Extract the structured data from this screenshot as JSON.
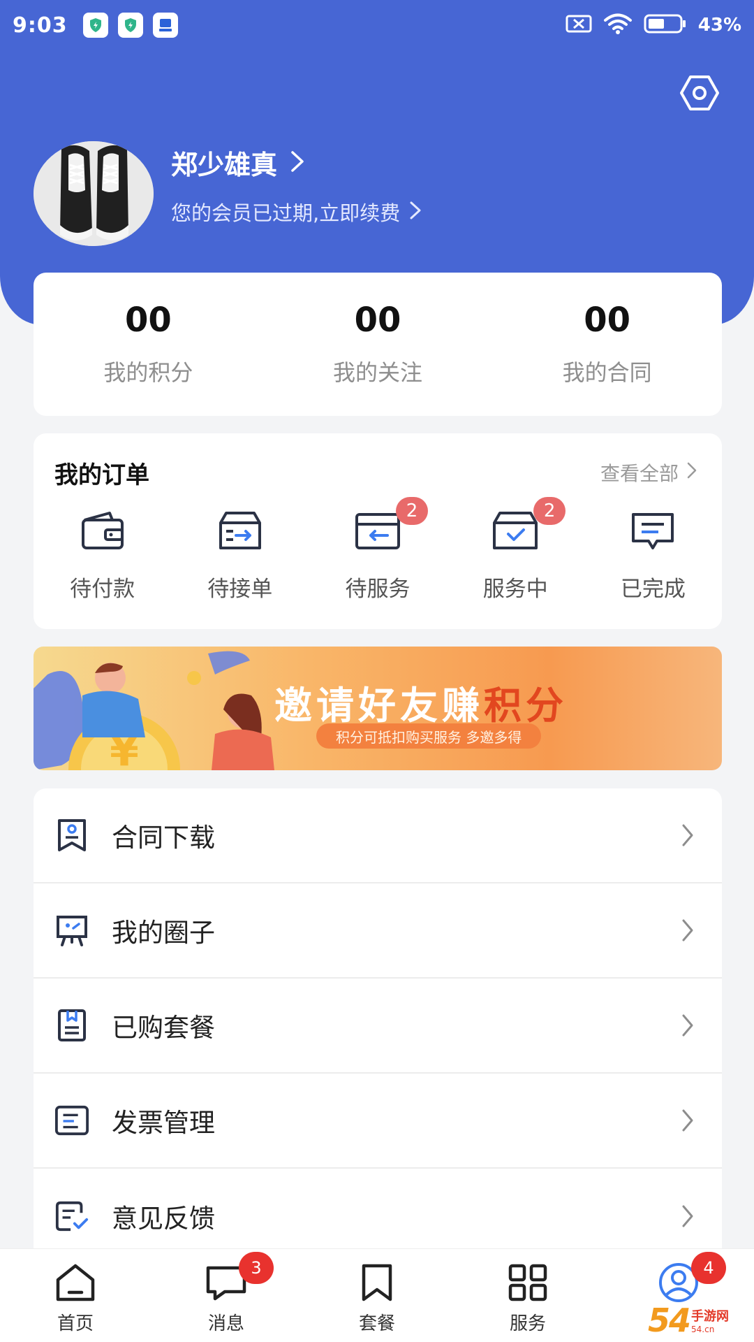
{
  "status_bar": {
    "time": "9:03",
    "battery": "43%"
  },
  "profile": {
    "name": "郑少雄真",
    "membership_notice": "您的会员已过期,立即续费"
  },
  "stats": [
    {
      "value": "00",
      "label": "我的积分"
    },
    {
      "value": "00",
      "label": "我的关注"
    },
    {
      "value": "00",
      "label": "我的合同"
    }
  ],
  "orders": {
    "title": "我的订单",
    "view_all": "查看全部",
    "items": [
      {
        "label": "待付款",
        "icon": "wallet-icon",
        "badge": ""
      },
      {
        "label": "待接单",
        "icon": "inbox-arrow-icon",
        "badge": ""
      },
      {
        "label": "待服务",
        "icon": "card-back-icon",
        "badge": "2"
      },
      {
        "label": "服务中",
        "icon": "box-check-icon",
        "badge": "2"
      },
      {
        "label": "已完成",
        "icon": "chat-lines-icon",
        "badge": ""
      }
    ]
  },
  "banner": {
    "title_main": "邀请好友赚",
    "title_highlight": "积分",
    "subtitle": "积分可抵扣购买服务 多邀多得"
  },
  "menu": [
    {
      "label": "合同下载",
      "icon": "contract-icon"
    },
    {
      "label": "我的圈子",
      "icon": "presentation-icon"
    },
    {
      "label": "已购套餐",
      "icon": "package-book-icon"
    },
    {
      "label": "发票管理",
      "icon": "invoice-icon"
    },
    {
      "label": "意见反馈",
      "icon": "feedback-icon"
    }
  ],
  "tab_bar": [
    {
      "label": "首页",
      "icon": "home-icon",
      "badge": ""
    },
    {
      "label": "消息",
      "icon": "message-icon",
      "badge": "3"
    },
    {
      "label": "套餐",
      "icon": "bookmark-icon",
      "badge": ""
    },
    {
      "label": "服务",
      "icon": "grid-icon",
      "badge": ""
    },
    {
      "label": "",
      "icon": "profile-icon",
      "badge": "4"
    }
  ],
  "watermark": {
    "number": "54",
    "brand": "手游网",
    "domain": "54.cn"
  },
  "colors": {
    "primary": "#4766d4",
    "badge_red": "#e86a6a",
    "tab_badge_red": "#e8322e",
    "icon_dark": "#2b3245",
    "icon_blue": "#3c7cf0"
  }
}
